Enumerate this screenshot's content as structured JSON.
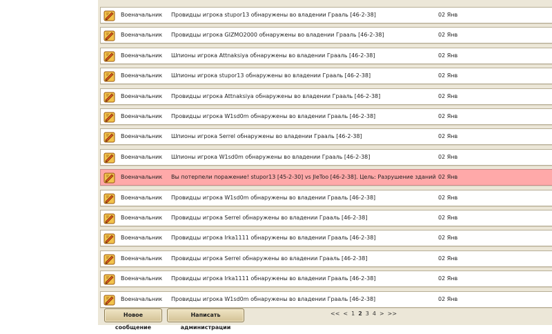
{
  "messages": [
    {
      "sender": "Военачальник",
      "subject": "Провидцы игрока stupor13 обнаружены во владении Грааль [46-2-38]",
      "date": "02 Янв",
      "alert": false
    },
    {
      "sender": "Военачальник",
      "subject": "Провидцы игрока GIZMO2000 обнаружены во владении Грааль [46-2-38]",
      "date": "02 Янв",
      "alert": false
    },
    {
      "sender": "Военачальник",
      "subject": "Шпионы игрока Attnaksiya обнаружены во владении Грааль [46-2-38]",
      "date": "02 Янв",
      "alert": false
    },
    {
      "sender": "Военачальник",
      "subject": "Шпионы игрока stupor13 обнаружены во владении Грааль [46-2-38]",
      "date": "02 Янв",
      "alert": false
    },
    {
      "sender": "Военачальник",
      "subject": "Провидцы игрока Attnaksiya обнаружены во владении Грааль [46-2-38]",
      "date": "02 Янв",
      "alert": false
    },
    {
      "sender": "Военачальник",
      "subject": "Провидцы игрока W1sd0m обнаружены во владении Грааль [46-2-38]",
      "date": "02 Янв",
      "alert": false
    },
    {
      "sender": "Военачальник",
      "subject": "Шпионы игрока Serrel обнаружены во владении Грааль [46-2-38]",
      "date": "02 Янв",
      "alert": false
    },
    {
      "sender": "Военачальник",
      "subject": "Шпионы игрока W1sd0m обнаружены во владении Грааль [46-2-38]",
      "date": "02 Янв",
      "alert": false
    },
    {
      "sender": "Военачальник",
      "subject": "Вы потерпели поражение! stupor13 [45-2-30] vs JleToo [46-2-38]. Цель: Разрушение зданий",
      "date": "02 Янв",
      "alert": true
    },
    {
      "sender": "Военачальник",
      "subject": "Провидцы игрока W1sd0m обнаружены во владении Грааль [46-2-38]",
      "date": "02 Янв",
      "alert": false
    },
    {
      "sender": "Военачальник",
      "subject": "Провидцы игрока Serrel обнаружены во владении Грааль [46-2-38]",
      "date": "02 Янв",
      "alert": false
    },
    {
      "sender": "Военачальник",
      "subject": "Провидцы игрока Irka1111 обнаружены во владении Грааль [46-2-38]",
      "date": "02 Янв",
      "alert": false
    },
    {
      "sender": "Военачальник",
      "subject": "Провидцы игрока Serrel обнаружены во владении Грааль [46-2-38]",
      "date": "02 Янв",
      "alert": false
    },
    {
      "sender": "Военачальник",
      "subject": "Провидцы игрока Irka1111 обнаружены во владении Грааль [46-2-38]",
      "date": "02 Янв",
      "alert": false
    },
    {
      "sender": "Военачальник",
      "subject": "Провидцы игрока W1sd0m обнаружены во владении Грааль [46-2-38]",
      "date": "02 Янв",
      "alert": false
    }
  ],
  "footer": {
    "new_message": "Новое сообщение",
    "write_admin": "Написать администрации",
    "pagination": [
      "<<",
      "<",
      "1",
      "2",
      "3",
      "4",
      ">",
      ">>"
    ],
    "current_page": "2"
  },
  "colors": {
    "panel_bg": "#ece7d8",
    "row_bg": "#ffffff",
    "alert_row_bg": "#ffa9a9",
    "button_bg": "#dccca0"
  },
  "icons": {
    "message": "scroll-quill-icon"
  }
}
